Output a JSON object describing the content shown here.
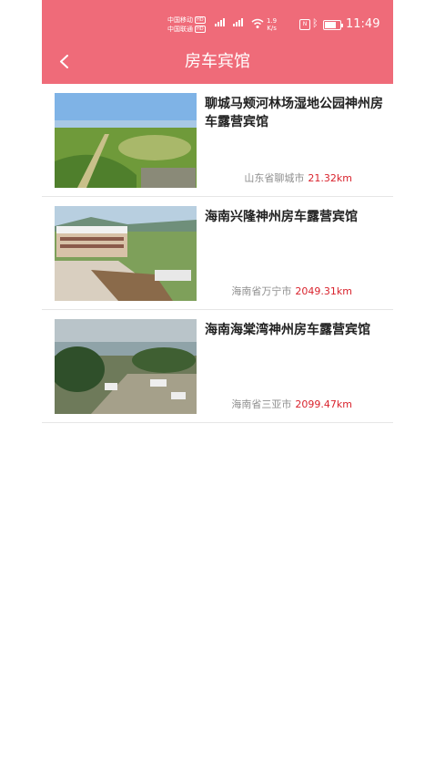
{
  "status_bar": {
    "carrier_1": "中国移动",
    "carrier_2": "中国联通",
    "hd": "HD",
    "network_speed_value": "1.9",
    "network_speed_unit": "K/s",
    "nfc": "N",
    "time": "11:49",
    "battery_level": 0.75,
    "icons": [
      "signal-icon",
      "wifi-icon",
      "nfc-icon",
      "bluetooth-icon",
      "battery-icon"
    ]
  },
  "header": {
    "title": "房车宾馆",
    "back_icon": "chevron-left-icon",
    "background_color": "#ef6b79"
  },
  "hotels": [
    {
      "name": "聊城马颊河林场湿地公园神州房车露营宾馆",
      "location": "山东省聊城市",
      "distance": "21.32km"
    },
    {
      "name": "海南兴隆神州房车露营宾馆",
      "location": "海南省万宁市",
      "distance": "2049.31km"
    },
    {
      "name": "海南海棠湾神州房车露营宾馆",
      "location": "海南省三亚市",
      "distance": "2099.47km"
    }
  ],
  "colors": {
    "distance": "#d9232d",
    "location": "#8f8f8f"
  }
}
